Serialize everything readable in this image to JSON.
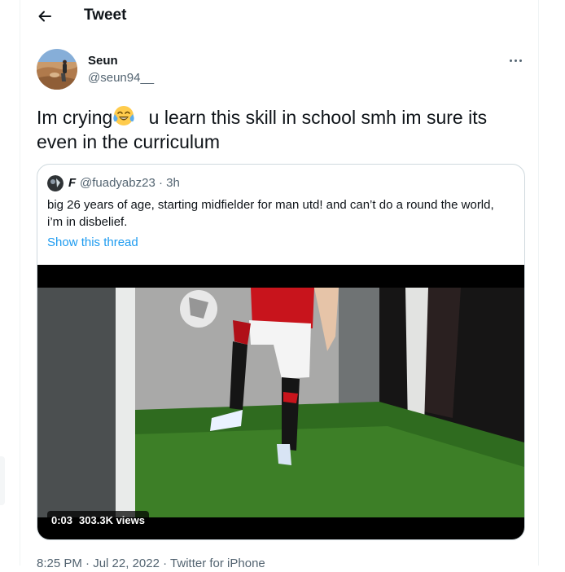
{
  "header": {
    "title": "Tweet"
  },
  "tweet": {
    "author_name": "Seun",
    "author_handle": "@seun94__",
    "text_before": "Im crying",
    "emoji": "face-with-tears-of-joy",
    "text_after": " u learn this skill in school smh im sure its even in the curriculum"
  },
  "quote": {
    "name": "F",
    "handle": "@fuadyabz23",
    "time": "3h",
    "text": "big 26 years of age, starting midfielder for man utd! and can’t do a round the world, i’m in disbelief.",
    "show_thread": "Show this thread"
  },
  "video": {
    "time": "0:03",
    "views": "303.3K views"
  },
  "meta": {
    "time": "8:25 PM",
    "date": "Jul 22, 2022",
    "source": "Twitter for iPhone"
  },
  "colors": {
    "accent": "#1d9bf0",
    "text": "#0f1419",
    "muted": "#536471",
    "border": "#cfd9de"
  }
}
